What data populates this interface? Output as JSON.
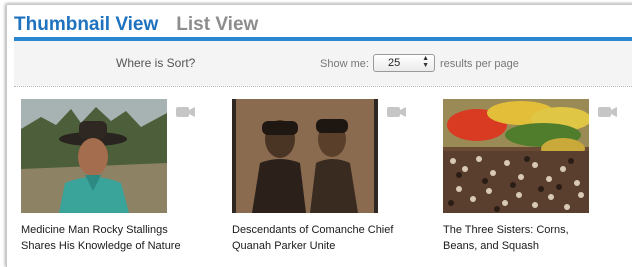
{
  "tabs": [
    {
      "label": "Thumbnail View",
      "active": true
    },
    {
      "label": "List View",
      "active": false
    }
  ],
  "sort_link": "Where is Sort?",
  "show_me_label": "Show me:",
  "per_page": {
    "selected": "25"
  },
  "results_label": "results per page",
  "colors": {
    "accent": "#1e72be",
    "tab_inactive": "#8d8d8d",
    "bar_bg": "#f4f4f4"
  },
  "items": [
    {
      "caption_line1": "Medicine Man Rocky Stallings",
      "caption_line2": "Shares His Knowledge of Nature",
      "media_icon": "video-camera-icon"
    },
    {
      "caption_line1": "Descendants of Comanche Chief",
      "caption_line2": "Quanah Parker Unite",
      "media_icon": "video-camera-icon"
    },
    {
      "caption_line1": "The Three Sisters: Corns,",
      "caption_line2": "Beans, and Squash",
      "media_icon": "video-camera-icon"
    }
  ]
}
